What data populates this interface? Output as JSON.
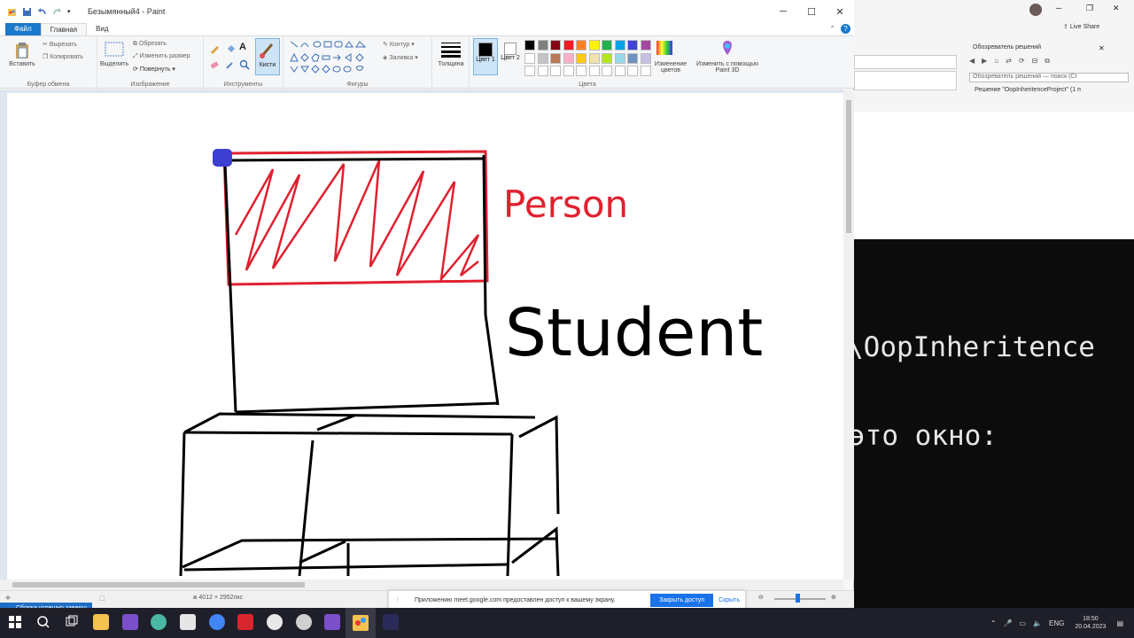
{
  "paint": {
    "title": "Безымянный4 - Paint",
    "tabs": [
      "Файл",
      "Главная",
      "Вид"
    ],
    "ribbon": {
      "clipboard": {
        "label": "Буфер обмена",
        "paste": "Вставить",
        "cut": "Вырезать",
        "copy": "Копировать"
      },
      "image": {
        "label": "Изображение",
        "select": "Выделить",
        "crop": "Обрезать",
        "resize": "Изменить размер",
        "rotate": "Повернуть"
      },
      "tools": {
        "label": "Инструменты",
        "brushes": "Кисти"
      },
      "shapes": {
        "label": "Фигуры",
        "outline": "Контур",
        "fill": "Заливка"
      },
      "size": "Толщина",
      "color1": "Цвет 1",
      "color2": "Цвет 2",
      "colors": {
        "label": "Цвета",
        "edit": "Изменение цветов"
      },
      "paint3d": "Изменить с помощью Paint 3D"
    },
    "canvas_text": {
      "person": "Person",
      "student": "Student"
    },
    "status": {
      "size": "4012 × 2952пкс"
    },
    "share_bar": {
      "text": "Приложению meet.google.com предоставлен доступ к вашему экрану.",
      "stop": "Закрыть доступ",
      "hide": "Скрыть"
    }
  },
  "vs": {
    "live_share": "Live Share",
    "solution_explorer": "Обозреватель решений",
    "search": "Обозреватель решений — поиск (Ct",
    "solution_item": "Решение \"OopInheritenceProject\" (1 п",
    "console_line1": "\\OopInheritence",
    "console_line2": "это окно:"
  },
  "taskbar": {
    "notification": "Сборка успешно заверш",
    "lang": "ENG",
    "time": "18:50",
    "date": "20.04.2023"
  },
  "palette": [
    "#000000",
    "#7f7f7f",
    "#880015",
    "#ed1c24",
    "#ff7f27",
    "#fff200",
    "#22b14c",
    "#00a2e8",
    "#3f48cc",
    "#a349a4",
    "#ffffff",
    "#c3c3c3",
    "#b97a57",
    "#ffaec9",
    "#ffc90e",
    "#efe4b0",
    "#b5e61d",
    "#99d9ea",
    "#7092be",
    "#c8bfe7"
  ]
}
